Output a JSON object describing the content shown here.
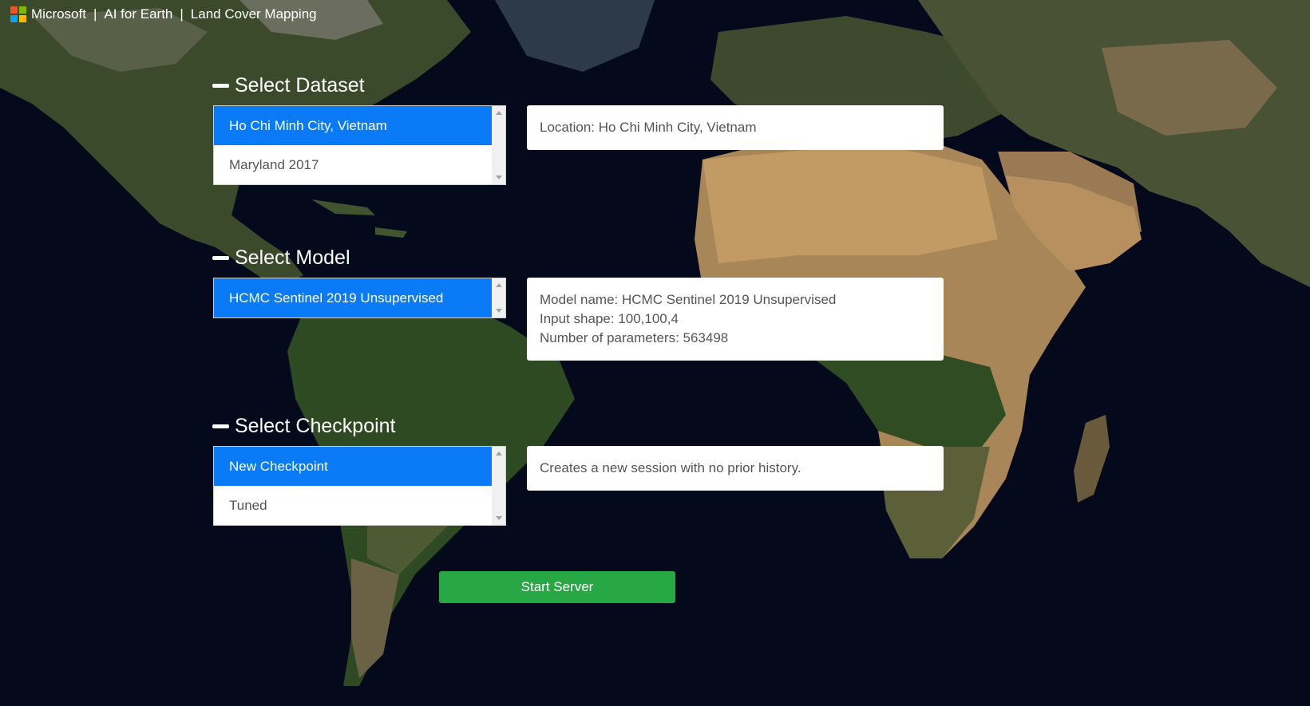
{
  "header": {
    "brand": "Microsoft",
    "separator": "|",
    "product": "AI for Earth",
    "app_title": "Land Cover Mapping"
  },
  "dataset": {
    "title": "Select Dataset",
    "options": [
      {
        "label": "Ho Chi Minh City, Vietnam",
        "selected": true
      },
      {
        "label": "Maryland 2017",
        "selected": false
      }
    ],
    "info": "Location: Ho Chi Minh City, Vietnam"
  },
  "model": {
    "title": "Select Model",
    "options": [
      {
        "label": "HCMC Sentinel 2019 Unsupervised",
        "selected": true
      }
    ],
    "info_lines": [
      "Model name: HCMC Sentinel 2019 Unsupervised",
      "Input shape: 100,100,4",
      "Number of parameters: 563498"
    ]
  },
  "checkpoint": {
    "title": "Select Checkpoint",
    "options": [
      {
        "label": "New Checkpoint",
        "selected": true
      },
      {
        "label": "Tuned",
        "selected": false
      }
    ],
    "info": "Creates a new session with no prior history."
  },
  "actions": {
    "start_label": "Start Server"
  },
  "colors": {
    "selected_item": "#0b7af7",
    "start_button": "#28a745",
    "background": "#040a1c"
  }
}
